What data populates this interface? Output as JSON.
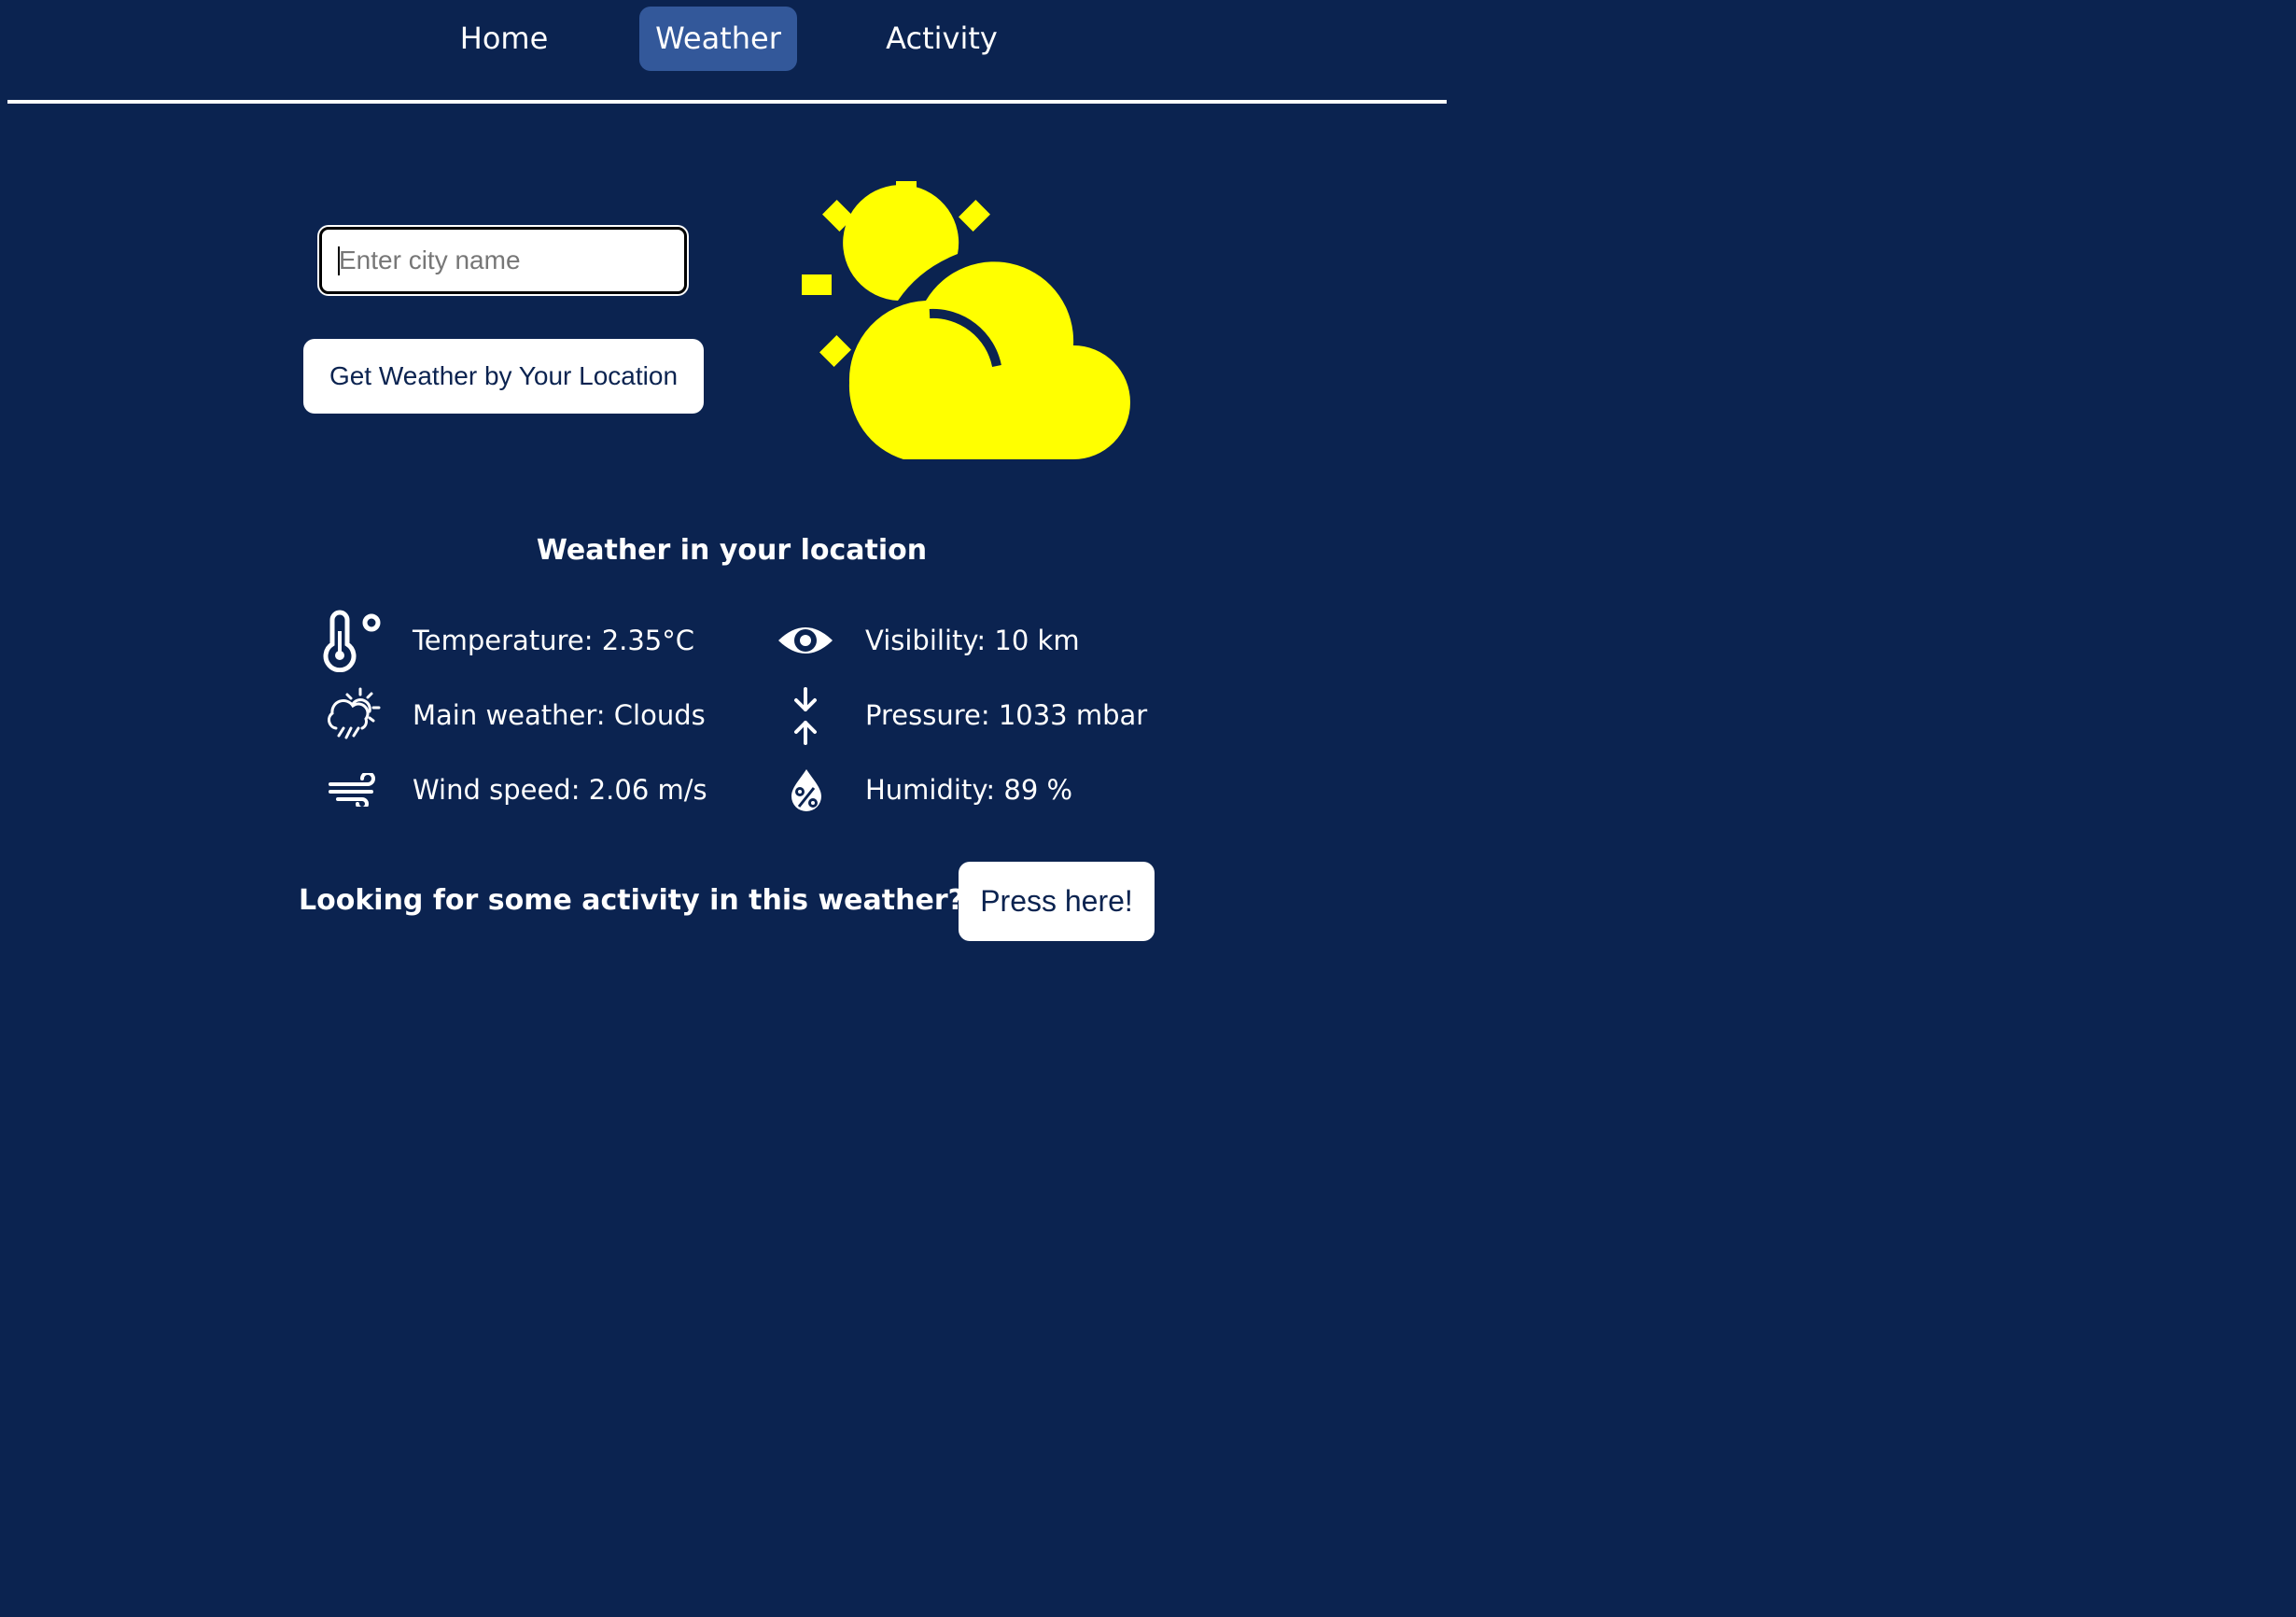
{
  "nav": {
    "items": [
      {
        "label": "Home",
        "active": false
      },
      {
        "label": "Weather",
        "active": true
      },
      {
        "label": "Activity",
        "active": false
      }
    ]
  },
  "search": {
    "placeholder": "Enter city name",
    "value": ""
  },
  "location_button": {
    "label": "Get Weather by Your Location"
  },
  "hero_icon": "sun-behind-cloud-icon",
  "weather": {
    "heading": "Weather in your location",
    "temperature": "Temperature: 2.35°C",
    "main": "Main weather: Clouds",
    "wind": "Wind speed: 2.06 m/s",
    "visibility": "Visibility: 10 km",
    "pressure": "Pressure: 1033 mbar",
    "humidity": "Humidity: 89 %"
  },
  "cta": {
    "text": "Looking for some activity in this weather?",
    "button_label": "Press here!"
  },
  "colors": {
    "background": "#0b2350",
    "nav_active": "#33589a",
    "hero_icon": "#ffff00",
    "text": "#ffffff"
  }
}
